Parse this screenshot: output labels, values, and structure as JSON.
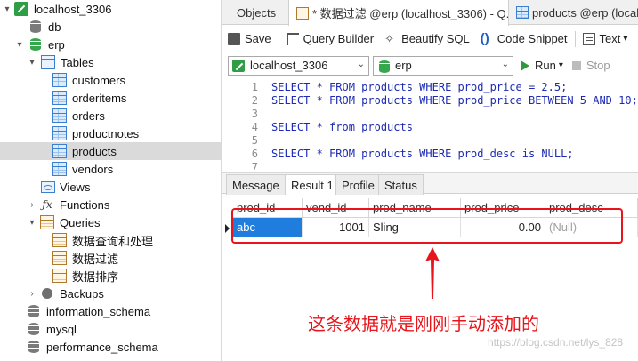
{
  "sidebar": {
    "items": [
      {
        "label": "localhost_3306",
        "icon": "connection-icon",
        "expanded": true,
        "level": 0
      },
      {
        "label": "db",
        "icon": "database-icon",
        "level": 1
      },
      {
        "label": "erp",
        "icon": "database-active-icon",
        "expanded": true,
        "level": 1
      },
      {
        "label": "Tables",
        "icon": "tables-folder-icon",
        "expanded": true,
        "level": 2
      },
      {
        "label": "customers",
        "icon": "table-icon",
        "level": 3
      },
      {
        "label": "orderitems",
        "icon": "table-icon",
        "level": 3
      },
      {
        "label": "orders",
        "icon": "table-icon",
        "level": 3
      },
      {
        "label": "productnotes",
        "icon": "table-icon",
        "level": 3
      },
      {
        "label": "products",
        "icon": "table-icon",
        "level": 3,
        "selected": true
      },
      {
        "label": "vendors",
        "icon": "table-icon",
        "level": 3
      },
      {
        "label": "Views",
        "icon": "views-icon",
        "level": 2
      },
      {
        "label": "Functions",
        "icon": "function-icon",
        "level": 2
      },
      {
        "label": "Queries",
        "icon": "queries-icon",
        "expanded": true,
        "level": 2
      },
      {
        "label": "数据查询和处理",
        "icon": "query-icon",
        "level": 3
      },
      {
        "label": "数据过滤",
        "icon": "query-icon",
        "level": 3
      },
      {
        "label": "数据排序",
        "icon": "query-icon",
        "level": 3
      },
      {
        "label": "Backups",
        "icon": "backups-icon",
        "level": 2
      },
      {
        "label": "information_schema",
        "icon": "database-icon",
        "level": 1
      },
      {
        "label": "mysql",
        "icon": "database-icon",
        "level": 1
      },
      {
        "label": "performance_schema",
        "icon": "database-icon",
        "level": 1
      }
    ]
  },
  "tabs": [
    {
      "label": "Objects"
    },
    {
      "label": "* 数据过滤 @erp (localhost_3306) - Q...",
      "active": true
    },
    {
      "label": "products @erp (localho"
    }
  ],
  "toolbar": {
    "save": "Save",
    "query_builder": "Query Builder",
    "beautify": "Beautify SQL",
    "snippet": "Code Snippet",
    "text": "Text"
  },
  "connbar": {
    "connection": "localhost_3306",
    "database": "erp",
    "run": "Run",
    "stop": "Stop"
  },
  "editor": {
    "lines": [
      {
        "no": "1",
        "code": "SELECT * FROM products WHERE prod_price = 2.5;"
      },
      {
        "no": "2",
        "code": "SELECT * FROM products WHERE prod_price BETWEEN 5 AND 10;"
      },
      {
        "no": "3",
        "code": ""
      },
      {
        "no": "4",
        "code": "SELECT * from products"
      },
      {
        "no": "5",
        "code": ""
      },
      {
        "no": "6",
        "code": "SELECT * FROM products WHERE prod_desc is NULL;"
      },
      {
        "no": "7",
        "code": ""
      }
    ]
  },
  "result_tabs": [
    {
      "label": "Message"
    },
    {
      "label": "Result 1",
      "active": true
    },
    {
      "label": "Profile"
    },
    {
      "label": "Status"
    }
  ],
  "grid": {
    "columns": [
      "prod_id",
      "vend_id",
      "prod_name",
      "prod_price",
      "prod_desc"
    ],
    "rows": [
      [
        "abc",
        "1001",
        "Sling",
        "0.00",
        "(Null)"
      ]
    ]
  },
  "annotation": "这条数据就是刚刚手动添加的",
  "watermark": "https://blog.csdn.net/lys_828",
  "colors": {
    "accent": "#1f7dde",
    "annotation": "#e8141b",
    "run": "#2f9a3c"
  }
}
